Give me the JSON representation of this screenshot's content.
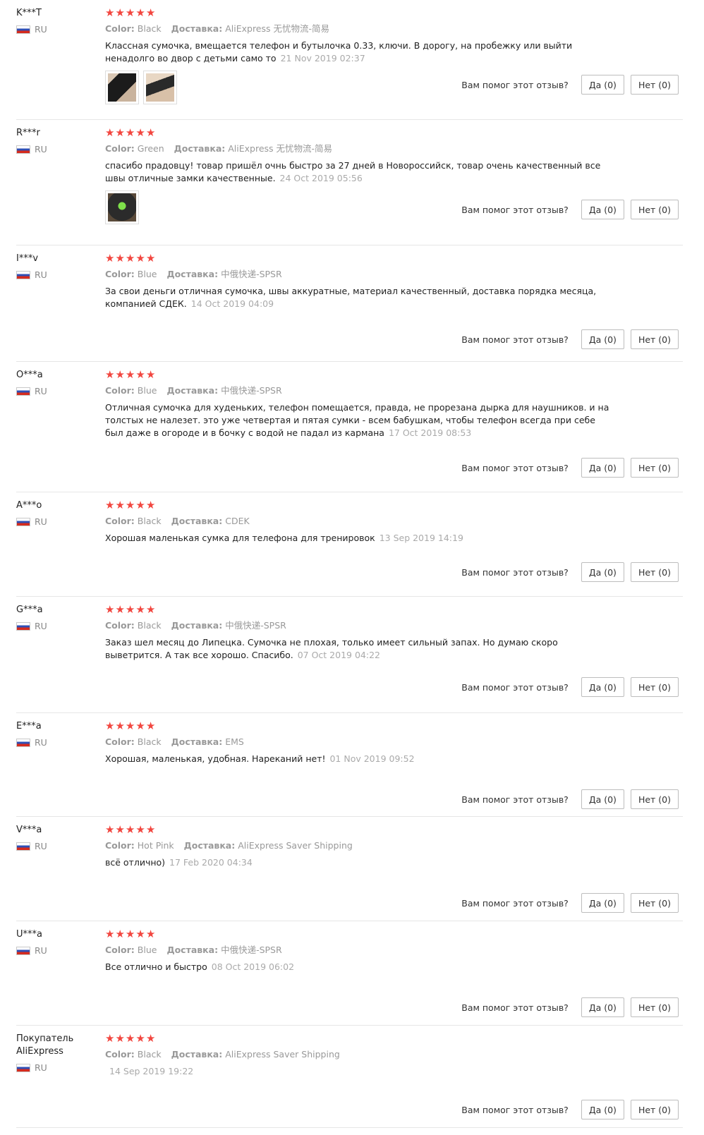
{
  "labels": {
    "color": "Color:",
    "shipping": "Доставка:",
    "helpful_question": "Вам помог этот отзыв?",
    "yes": "Да (0)",
    "no": "Нет (0)"
  },
  "colors": {
    "star": "#f2463f",
    "muted": "#999999",
    "divider": "#e6e6e6"
  },
  "reviews": [
    {
      "user": "K***T",
      "country": "RU",
      "stars": 5,
      "color": "Black",
      "shipping": "AliExpress 无忧物流-简易",
      "text": "Классная сумочка, вмещается телефон и бутылочка 0.33, ключи. В дорогу, на пробежку или выйти ненадолго во двор с детьми само то",
      "date": "21 Nov 2019 02:37",
      "photos": [
        "black-bag-photo",
        "black-bag-photo-2"
      ]
    },
    {
      "user": "R***r",
      "country": "RU",
      "stars": 5,
      "color": "Green",
      "shipping": "AliExpress 无忧物流-简易",
      "text": "спасибо прадовцу! товар пришёл очнь быстро за 27 дней в Новороссийск, товар очень качественный все швы отличные замки качественные.",
      "date": "24 Oct 2019 05:56",
      "photos": [
        "green-bag-photo"
      ]
    },
    {
      "user": "I***v",
      "country": "RU",
      "stars": 5,
      "color": "Blue",
      "shipping": "中俄快递-SPSR",
      "text": "За свои деньги отличная сумочка, швы аккуратные, материал качественный, доставка порядка месяца, компанией СДЕК.",
      "date": "14 Oct 2019 04:09",
      "photos": []
    },
    {
      "user": "O***a",
      "country": "RU",
      "stars": 5,
      "color": "Blue",
      "shipping": "中俄快递-SPSR",
      "text": "Отличная сумочка для худеньких, телефон помещается, правда, не прорезана дырка для наушников. и на толстых не налезет. это уже четвертая и пятая сумки - всем бабушкам, чтобы телефон всегда при себе был даже в огороде и в бочку с водой не падал из кармана",
      "date": "17 Oct 2019 08:53",
      "photos": []
    },
    {
      "user": "A***o",
      "country": "RU",
      "stars": 5,
      "color": "Black",
      "shipping": "CDEK",
      "text": "Хорошая маленькая сумка для телефона для тренировок",
      "date": "13 Sep 2019 14:19",
      "photos": []
    },
    {
      "user": "G***a",
      "country": "RU",
      "stars": 5,
      "color": "Black",
      "shipping": "中俄快递-SPSR",
      "text": "Заказ шел месяц до Липецка. Сумочка не плохая, только имеет сильный запах. Но думаю скоро выветрится. А так все хорошо. Спасибо.",
      "date": "07 Oct 2019 04:22",
      "photos": []
    },
    {
      "user": "E***a",
      "country": "RU",
      "stars": 5,
      "color": "Black",
      "shipping": "EMS",
      "text": "Хорошая, маленькая, удобная. Нареканий нет!",
      "date": "01 Nov 2019 09:52",
      "photos": []
    },
    {
      "user": "V***a",
      "country": "RU",
      "stars": 5,
      "color": "Hot Pink",
      "shipping": "AliExpress Saver Shipping",
      "text": "всё отлично)",
      "date": "17 Feb 2020 04:34",
      "photos": []
    },
    {
      "user": "U***a",
      "country": "RU",
      "stars": 5,
      "color": "Blue",
      "shipping": "中俄快递-SPSR",
      "text": "Все отлично и быстро",
      "date": "08 Oct 2019 06:02",
      "photos": []
    },
    {
      "user": "Покупатель AliExpress",
      "country": "RU",
      "stars": 5,
      "color": "Black",
      "shipping": "AliExpress Saver Shipping",
      "text": "",
      "date": "14 Sep 2019 19:22",
      "photos": []
    }
  ]
}
